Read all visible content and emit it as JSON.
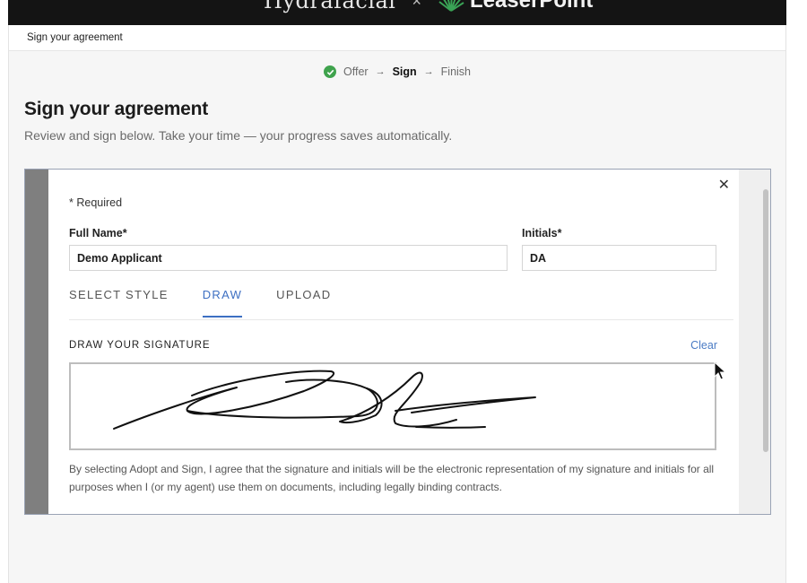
{
  "header": {
    "brand_left": "Hydrafacial",
    "separator": "×",
    "brand_right": "LeaserPoint"
  },
  "breadcrumb": {
    "label": "Sign your agreement"
  },
  "stepper": {
    "steps": [
      {
        "label": "Offer",
        "state": "done"
      },
      {
        "label": "Sign",
        "state": "active"
      },
      {
        "label": "Finish",
        "state": "pending"
      }
    ],
    "arrow": "→"
  },
  "page": {
    "title": "Sign your agreement",
    "subtitle": "Review and sign below. Take your time — your progress saves automatically."
  },
  "modal": {
    "close_symbol": "✕",
    "required_note": "* Required",
    "full_name": {
      "label": "Full Name*",
      "value": "Demo Applicant"
    },
    "initials": {
      "label": "Initials*",
      "value": "DA"
    },
    "tabs": [
      {
        "label": "SELECT STYLE",
        "active": false
      },
      {
        "label": "DRAW",
        "active": true
      },
      {
        "label": "UPLOAD",
        "active": false
      }
    ],
    "draw_heading": "DRAW YOUR SIGNATURE",
    "clear_label": "Clear",
    "legal_text": "By selecting Adopt and Sign, I agree that the signature and initials will be the electronic representation of my signature and initials for all purposes when I (or my agent) use them on documents, including legally binding contracts."
  },
  "colors": {
    "accent": "#3d6fc2",
    "success": "#3fa34d",
    "topbar": "#141414"
  },
  "icons": [
    "check-icon",
    "arrow-right-icon",
    "close-icon",
    "leaf-logo-icon",
    "mouse-pointer-icon"
  ]
}
